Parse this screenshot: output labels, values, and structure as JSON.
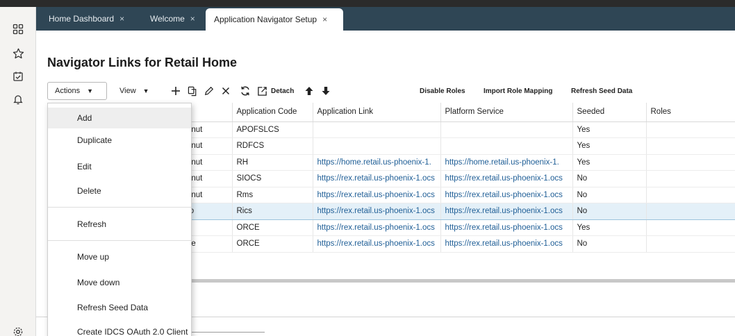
{
  "tabs": [
    {
      "label": "Home Dashboard",
      "close": "×"
    },
    {
      "label": "Welcome",
      "close": "×"
    },
    {
      "label": "Application Navigator Setup",
      "close": "×"
    }
  ],
  "page_title": "Navigator Links for Retail Home",
  "toolbar": {
    "actions_label": "Actions",
    "view_label": "View",
    "detach_label": "Detach",
    "disable_roles_label": "Disable Roles",
    "import_role_mapping_label": "Import Role Mapping",
    "refresh_seed_data_label": "Refresh Seed Data"
  },
  "icons": {
    "rail": [
      "apps-icon",
      "star-icon",
      "checklist-icon",
      "bell-icon",
      "gear-icon"
    ],
    "toolbar": [
      "add-icon",
      "duplicate-icon",
      "edit-icon",
      "delete-icon",
      "refresh-icon",
      "detach-icon",
      "move-up-icon",
      "move-down-icon"
    ]
  },
  "table": {
    "columns": [
      "et",
      "Application Code",
      "Application Link",
      "Platform Service",
      "Seeded",
      "Roles"
    ],
    "rows": [
      [
        "estnut",
        "APOFSLCS",
        "",
        "",
        "Yes",
        ""
      ],
      [
        "estnut",
        "RDFCS",
        "",
        "",
        "Yes",
        ""
      ],
      [
        "estnut",
        "RH",
        "https://home.retail.us-phoenix-1.",
        "https://home.retail.us-phoenix-1.",
        "Yes",
        ""
      ],
      [
        "estnut",
        "SIOCS",
        "https://rex.retail.us-phoenix-1.ocs",
        "https://rex.retail.us-phoenix-1.ocs",
        "No",
        ""
      ],
      [
        "estnut",
        "Rms",
        "https://rex.retail.us-phoenix-1.ocs",
        "https://rex.retail.us-phoenix-1.ocs",
        "No",
        ""
      ],
      [
        "ngo",
        "Rics",
        "https://rex.retail.us-phoenix-1.ocs",
        "https://rex.retail.us-phoenix-1.ocs",
        "No",
        ""
      ],
      [
        "an",
        "ORCE",
        "https://rex.retail.us-phoenix-1.ocs",
        "https://rex.retail.us-phoenix-1.ocs",
        "Yes",
        ""
      ],
      [
        "ngle",
        "ORCE",
        "https://rex.retail.us-phoenix-1.ocs",
        "https://rex.retail.us-phoenix-1.ocs",
        "No",
        ""
      ]
    ],
    "selected_row": 5
  },
  "actions_menu": {
    "items": [
      "Add",
      "Duplicate",
      "Edit",
      "Delete",
      "Refresh",
      "Move up",
      "Move down",
      "Refresh Seed Data",
      "Create IDCS OAuth 2.0 Client"
    ],
    "highlighted": 0
  },
  "colors": {
    "tabstrip": "#2f4655",
    "selected_row": "#e4f0f8",
    "link": "#1f5e96"
  }
}
